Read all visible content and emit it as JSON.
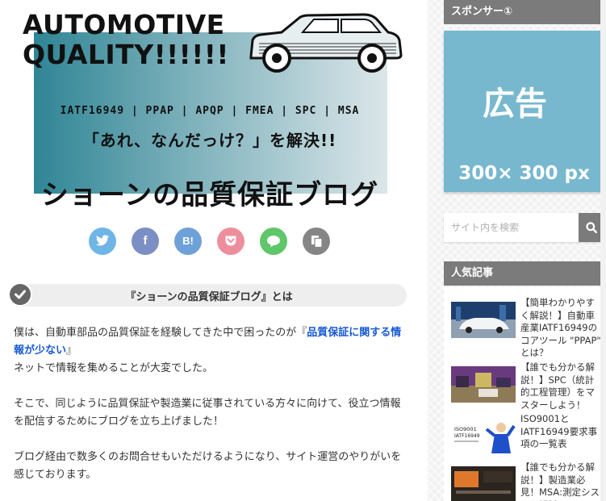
{
  "banner": {
    "title_line1": "AUTOMOTIVE",
    "title_line2": "QUALITY!!!!!!",
    "tags": "IATF16949 | PPAP | APQP | FMEA | SPC | MSA",
    "tagline": "「あれ、なんだっけ？」を解決!!",
    "blog_name": "ショーンの品質保証ブログ"
  },
  "share": {
    "buttons": [
      {
        "name": "twitter",
        "label": "",
        "color": "#6fb6e7",
        "icon": "twitter-bird-icon"
      },
      {
        "name": "facebook",
        "label": "f",
        "color": "#7b8fc4",
        "icon": "facebook-icon"
      },
      {
        "name": "hatena",
        "label": "B!",
        "color": "#6fa1d9",
        "icon": "hatena-bookmark-icon"
      },
      {
        "name": "pocket",
        "label": "",
        "color": "#ee8e9c",
        "icon": "pocket-icon"
      },
      {
        "name": "line",
        "label": "",
        "color": "#5fc66a",
        "icon": "line-chat-icon"
      },
      {
        "name": "copy",
        "label": "",
        "color": "#858585",
        "icon": "copy-icon"
      }
    ]
  },
  "article": {
    "heading": "『ショーンの品質保証ブログ』とは",
    "p1_prefix": "僕は、自動車部品の品質保証を経験してきた中で困ったのが『",
    "p1_link": "品質保証に関する情報が少ない",
    "p1_suffix": "』",
    "p1_line2": "ネットで情報を集めることが大変でした。",
    "p2": "そこで、同じように品質保証や製造業に従事されている方々に向けて、役立つ情報を配信するためにブログを立ち上げました！",
    "p3": "ブログ経由で数多くのお問合せもいただけるようになり、サイト運営のやりがいを感じております。"
  },
  "sidebar": {
    "sponsor_title": "スポンサー①",
    "ad_main": "広告",
    "ad_size": "300× 300 px",
    "search_placeholder": "サイト内を検索",
    "popular_title": "人気記事",
    "popular": [
      {
        "title": "【簡単わかりやすく解説！】自動車産業IATF16949のコアツール \"PPAP\" とは？",
        "thumb": "car-thumbnail"
      },
      {
        "title": "【誰でも分かる解説！】SPC（統計的工程管理）をマスターしよう！",
        "thumb": "factory-thumbnail"
      },
      {
        "title": "ISO9001とIATF16949要求事項の一覧表",
        "thumb": "iso-thumbnail"
      },
      {
        "title": "【誰でも分かる解説！】製造業必見！MSA:測定システム解析",
        "thumb": "measure-thumbnail"
      }
    ]
  },
  "colors": {
    "widget_header": "#7b7b7b",
    "ad_bg": "#78b8cf",
    "link": "#1558d6",
    "banner_gradient_start": "#2f8595",
    "banner_gradient_end": "#dbe6e9"
  }
}
